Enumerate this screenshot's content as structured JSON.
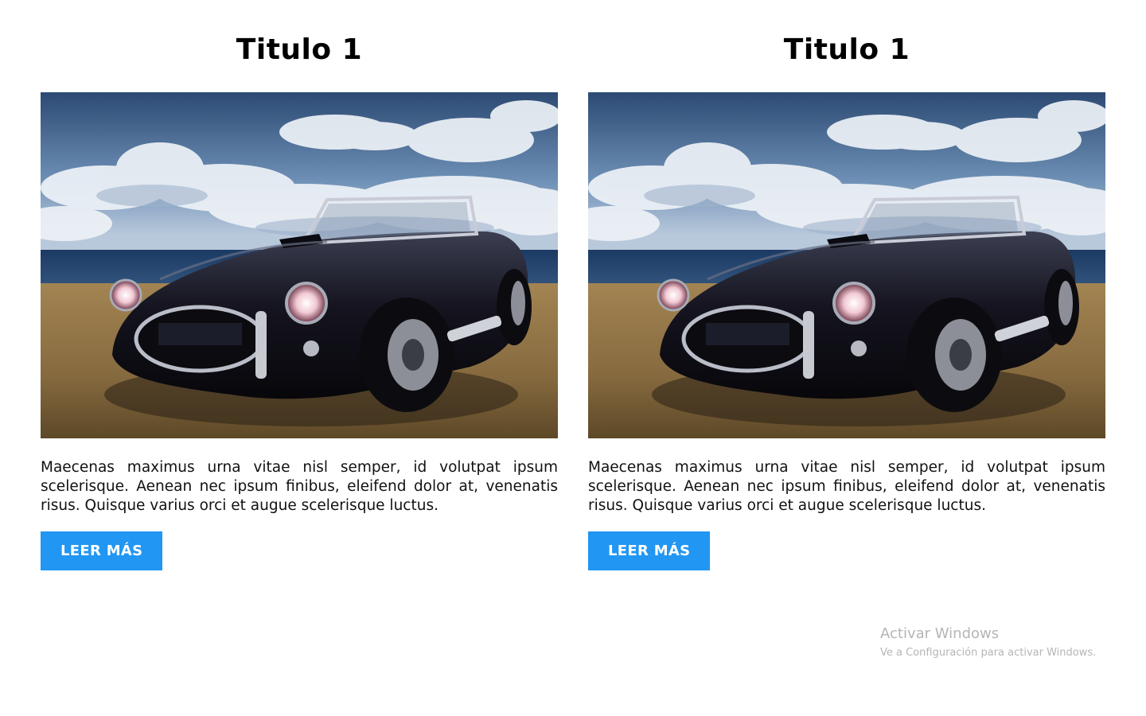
{
  "cards": [
    {
      "title": "Titulo 1",
      "image_alt": "black classic convertible car on a sandy beach under cloudy sky",
      "text": "Maecenas maximus urna vitae nisl semper, id volutpat ipsum scelerisque. Aenean nec ipsum finibus, eleifend dolor at, venenatis risus. Quisque varius orci et augue scelerisque luctus.",
      "button_label": "LEER MÁS"
    },
    {
      "title": "Titulo 1",
      "image_alt": "black classic convertible car on a sandy beach under cloudy sky",
      "text": "Maecenas maximus urna vitae nisl semper, id volutpat ipsum scelerisque. Aenean nec ipsum finibus, eleifend dolor at, venenatis risus. Quisque varius orci et augue scelerisque luctus.",
      "button_label": "LEER MÁS"
    }
  ],
  "watermark": {
    "title": "Activar Windows",
    "subtitle": "Ve a Configuración para activar Windows."
  },
  "colors": {
    "button_bg": "#2196f3",
    "button_text": "#ffffff",
    "title_text": "#000000",
    "body_text": "#111111",
    "watermark_text": "#b5b5b5"
  }
}
